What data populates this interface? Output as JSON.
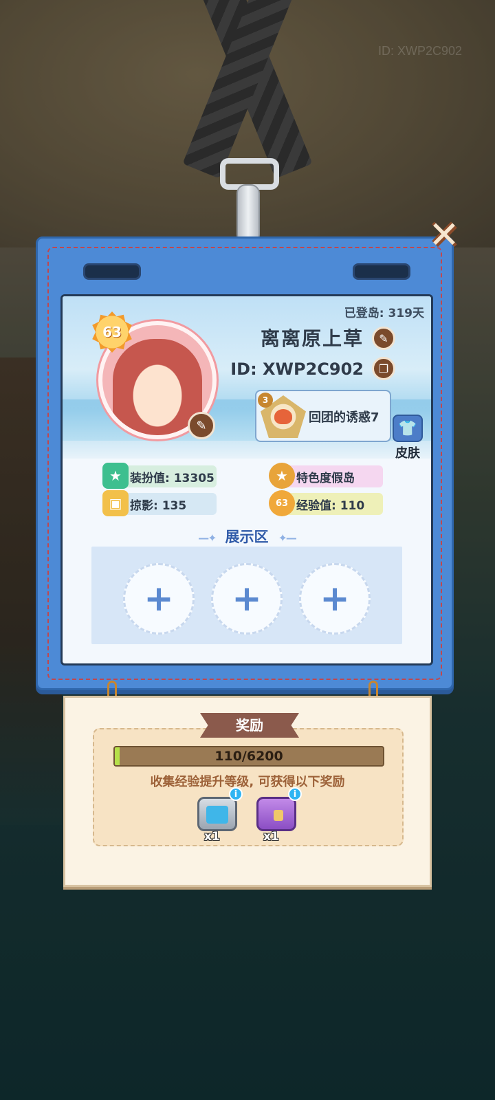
{
  "background": {
    "watermark": "ID: XWP2C902"
  },
  "card": {
    "days_on_island": "已登岛: 319天",
    "level": "63",
    "name": "离离原上草",
    "id": "ID: XWP2C902",
    "title_lv": "3",
    "title_label": "回团的诱惑7",
    "skin_label": "皮肤",
    "stats": {
      "dress_value": "装扮值: 13305",
      "photos": "掠影: 135",
      "island_type": "特色度假岛",
      "exp": "经验值: 110",
      "exp_badge": "63"
    },
    "showcase_title": "展示区",
    "showcase_slots": [
      "+",
      "+",
      "+"
    ]
  },
  "rewards": {
    "title": "奖励",
    "progress_text": "110/6200",
    "progress_fraction": 0.0177,
    "note": "收集经验提升等级, 可获得以下奖励",
    "items": [
      {
        "icon": "energy-chest-icon",
        "qty": "x1"
      },
      {
        "icon": "purple-chest-icon",
        "qty": "x1"
      }
    ],
    "info_glyph": "i"
  },
  "icons": {
    "close": "✕",
    "edit": "✎",
    "copy": "❐",
    "shirt": "👕",
    "star": "★",
    "photo": "▣"
  },
  "colors": {
    "card_blue": "#4d8ad6",
    "accent_brown": "#7a4a2c",
    "progress_green": "#b6e04a"
  }
}
